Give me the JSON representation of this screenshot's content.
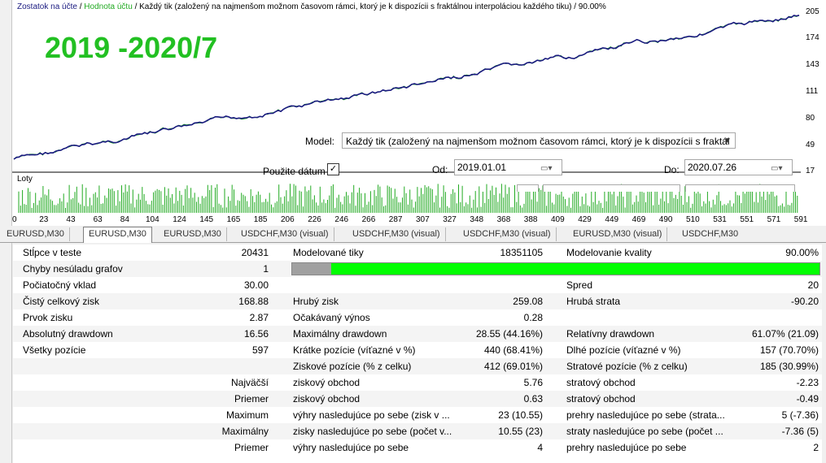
{
  "chart": {
    "legend": {
      "balance_label": "Zostatok na účte",
      "sep1": "/",
      "equity_label": "Hodnota účtu",
      "sep2": "/",
      "model_text": "Každý tik (založený na najmenšom možnom časovom rámci, ktorý je k dispozícii s fraktálnou interpoláciou každého tiku)",
      "quality": "/ 90.00%"
    },
    "overlay_title": "2019 -2020/7",
    "y_ticks": [
      "205",
      "174",
      "143",
      "111",
      "80",
      "49",
      "17"
    ],
    "x_ticks": [
      "0",
      "23",
      "43",
      "63",
      "84",
      "104",
      "124",
      "145",
      "165",
      "185",
      "206",
      "226",
      "246",
      "266",
      "287",
      "307",
      "327",
      "348",
      "368",
      "388",
      "409",
      "429",
      "449",
      "469",
      "490",
      "510",
      "531",
      "551",
      "571",
      "591"
    ],
    "lots_label": "Loty",
    "colors": {
      "balance": "#1a1a80",
      "equity": "#22aa22",
      "title": "#22c022"
    }
  },
  "controls": {
    "model_label": "Model:",
    "model_value": "Každý tik (založený na najmenšom možnom časovom rámci, ktorý je k dispozícii s fraktál",
    "use_date_label": "Použite dátum",
    "use_date_checked": "✓",
    "from_label": "Od:",
    "from_value": "2019.01.01",
    "to_label": "Do:",
    "to_value": "2020.07.26"
  },
  "tabs": [
    "EURUSD,M30",
    "EURUSD,M30",
    "EURUSD,M30",
    "USDCHF,M30 (visual)",
    "USDCHF,M30 (visual)",
    "USDCHF,M30 (visual)",
    "EURUSD,M30 (visual)",
    "USDCHF,M30"
  ],
  "report": {
    "bars_label": "Stĺpce v teste",
    "bars_value": "20431",
    "ticks_label": "Modelované tiky",
    "ticks_value": "18351105",
    "quality_label": "Modelovanie kvality",
    "quality_value": "90.00%",
    "mismatch_label": "Chyby nesúladu grafov",
    "mismatch_value": "1",
    "quality_fraction": 0.9,
    "deposit_label": "Počiatočný vklad",
    "deposit_value": "30.00",
    "spread_label": "Spred",
    "spread_value": "20",
    "net_label": "Čistý celkový zisk",
    "net_value": "168.88",
    "gross_profit_label": "Hrubý zisk",
    "gross_profit_value": "259.08",
    "gross_loss_label": "Hrubá strata",
    "gross_loss_value": "-90.20",
    "pf_label": "Prvok zisku",
    "pf_value": "2.87",
    "payoff_label": "Očakávaný výnos",
    "payoff_value": "0.28",
    "abs_dd_label": "Absolutný drawdown",
    "abs_dd_value": "16.56",
    "max_dd_label": "Maximálny drawdown",
    "max_dd_value": "28.55 (44.16%)",
    "rel_dd_label": "Relatívny drawdown",
    "rel_dd_value": "61.07% (21.09)",
    "total_label": "Všetky pozície",
    "total_value": "597",
    "short_label": "Krátke pozície (víťazné v %)",
    "short_value": "440 (68.41%)",
    "long_label": "Dlhé pozície (víťazné v %)",
    "long_value": "157 (70.70%)",
    "profit_tr_label": "Ziskové pozície (% z celku)",
    "profit_tr_value": "412 (69.01%)",
    "loss_tr_label": "Stratové pozície (% z celku)",
    "loss_tr_value": "185 (30.99%)",
    "largest_label": "Najväčší",
    "largest_p_label": "ziskový obchod",
    "largest_p_value": "5.76",
    "largest_l_label": "stratový obchod",
    "largest_l_value": "-2.23",
    "avg_label": "Priemer",
    "avg_p_label": "ziskový obchod",
    "avg_p_value": "0.63",
    "avg_l_label": "stratový obchod",
    "avg_l_value": "-0.49",
    "max_label": "Maximum",
    "max_p_label": "výhry nasledujúce po sebe (zisk v ...",
    "max_p_value": "23 (10.55)",
    "max_l_label": "prehry nasledujúce po sebe (strata...",
    "max_l_value": "5 (-7.36)",
    "maximal_label": "Maximálny",
    "maximal_p_label": "zisky nasledujúce po sebe (počet v...",
    "maximal_p_value": "10.55 (23)",
    "maximal_l_label": "straty nasledujúce po sebe (počet ...",
    "maximal_l_value": "-7.36 (5)",
    "avg2_label": "Priemer",
    "avg2_p_label": "výhry nasledujúce po sebe",
    "avg2_p_value": "4",
    "avg2_l_label": "prehry nasledujúce po sebe",
    "avg2_l_value": "2"
  }
}
